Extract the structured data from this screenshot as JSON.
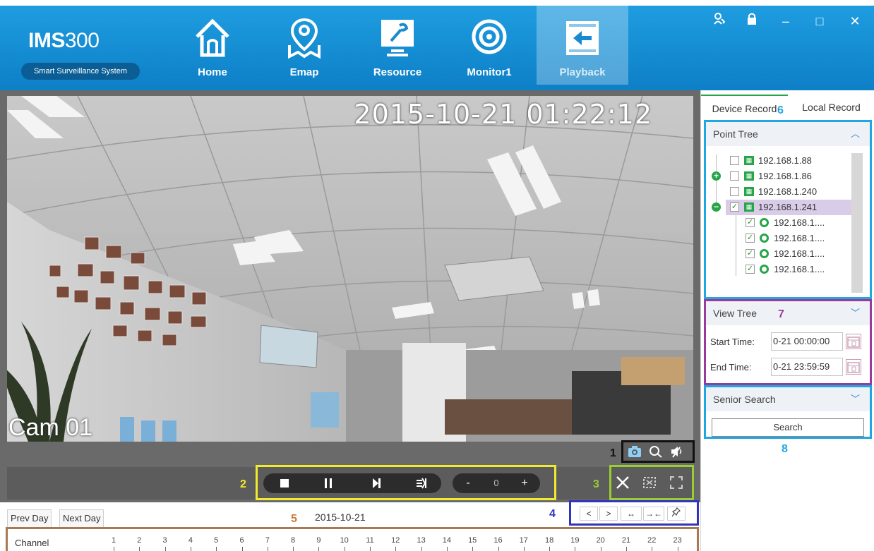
{
  "app": {
    "title_bold": "IMS",
    "title_num": "300",
    "subtitle": "Smart Surveillance System"
  },
  "nav": [
    {
      "label": "Home",
      "icon": "home-icon"
    },
    {
      "label": "Emap",
      "icon": "map-pin-icon"
    },
    {
      "label": "Resource",
      "icon": "wrench-monitor-icon"
    },
    {
      "label": "Monitor1",
      "icon": "camera-lens-icon"
    },
    {
      "label": "Playback",
      "icon": "playback-icon",
      "active": true
    }
  ],
  "window": {
    "user": "user-icon",
    "lock": "lock-icon",
    "minimize": "–",
    "maximize": "□",
    "close": "✕"
  },
  "video": {
    "osd_time": "2015-10-21  01:22:12",
    "osd_camera": "Cam 01"
  },
  "playback": {
    "speed_minus": "-",
    "speed_value": "0",
    "speed_plus": "+"
  },
  "annotations": {
    "n1": "1",
    "n2": "2",
    "n3": "3",
    "n4": "4",
    "n5": "5",
    "n6": "6",
    "n7": "7",
    "n8": "8"
  },
  "timeline": {
    "prev_day": "Prev Day",
    "next_day": "Next Day",
    "date": "2015-10-21",
    "channel_label": "Channel",
    "hours": [
      "1",
      "2",
      "3",
      "4",
      "5",
      "6",
      "7",
      "8",
      "9",
      "10",
      "11",
      "12",
      "13",
      "14",
      "15",
      "16",
      "17",
      "18",
      "19",
      "20",
      "21",
      "22",
      "23"
    ],
    "nav": {
      "prev": "<",
      "next": ">",
      "expand": "↔",
      "shrink": "→←",
      "pin": "📌"
    }
  },
  "panel": {
    "tabs": {
      "device": "Device Record",
      "local": "Local Record"
    },
    "point_tree": {
      "title": "Point Tree",
      "nodes": [
        {
          "label": "192.168.1.88"
        },
        {
          "label": "192.168.1.86"
        },
        {
          "label": "192.168.1.240"
        },
        {
          "label": "192.168.1.241"
        },
        {
          "label": "192.168.1...."
        },
        {
          "label": "192.168.1...."
        },
        {
          "label": "192.168.1...."
        },
        {
          "label": "192.168.1...."
        }
      ]
    },
    "view_tree": {
      "title": "View Tree",
      "start_label": "Start Time:",
      "start_value": "0-21 00:00:00",
      "end_label": "End Time:",
      "end_value": "0-21 23:59:59"
    },
    "senior_search": {
      "title": "Senior Search",
      "button": "Search"
    }
  },
  "colors": {
    "header": "#1a93d8",
    "accent": "#1ea7e1",
    "device_green": "#27a547"
  }
}
